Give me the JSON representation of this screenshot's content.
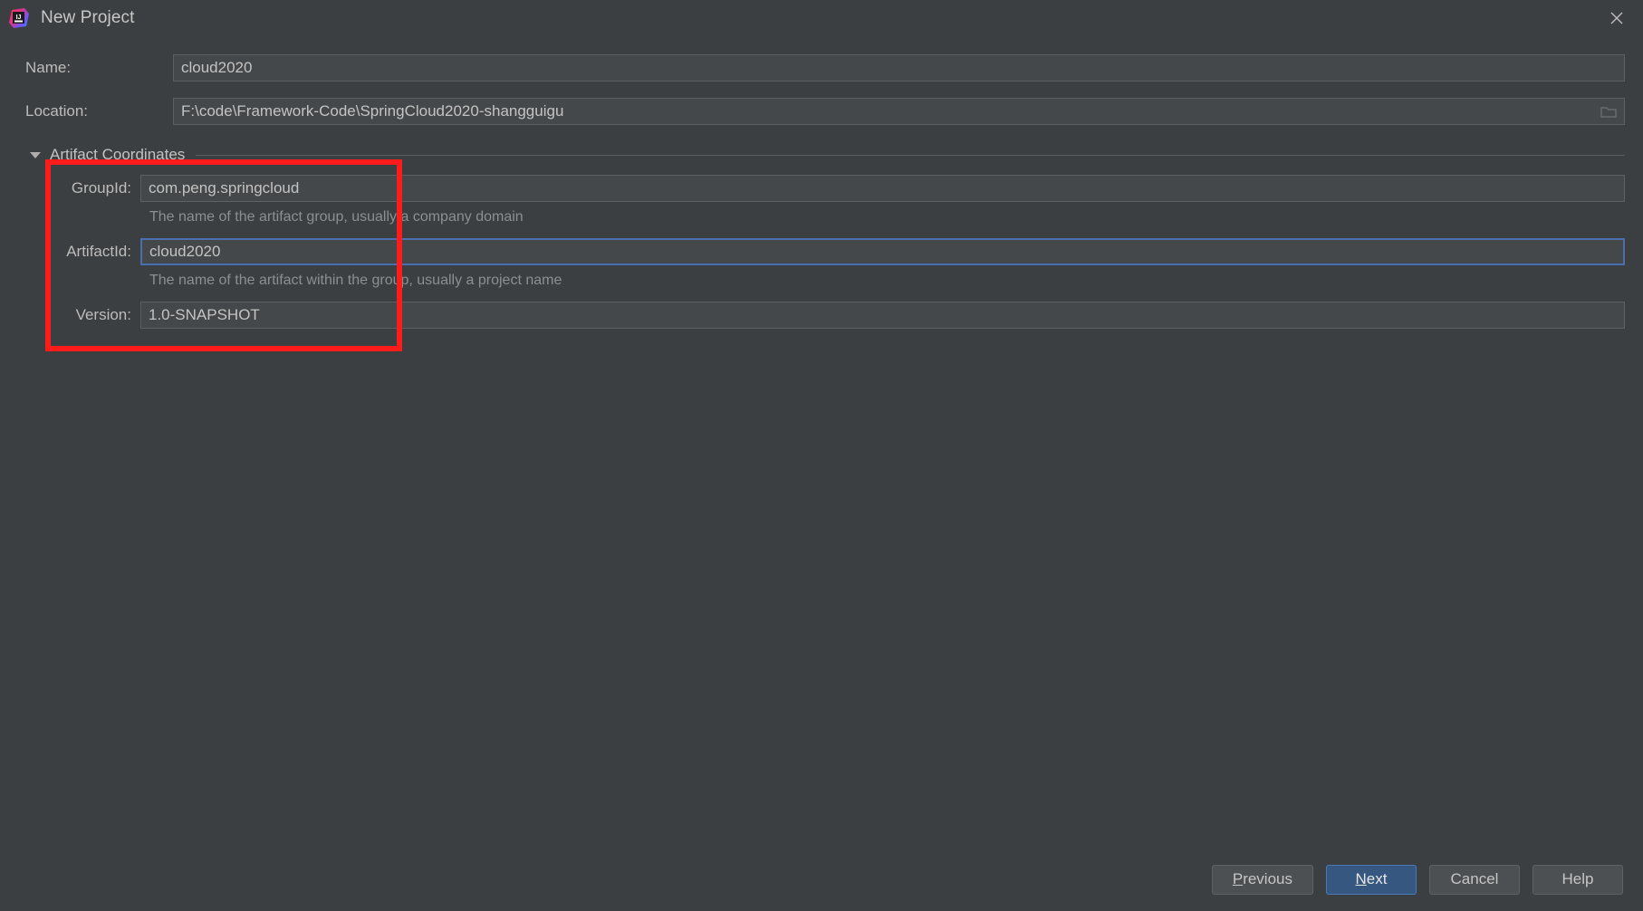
{
  "window": {
    "title": "New Project",
    "app_icon": "intellij-idea-logo",
    "close_icon": "close-icon"
  },
  "form": {
    "name_label": "Name:",
    "name_value": "cloud2020",
    "location_label": "Location:",
    "location_value": "F:\\code\\Framework-Code\\SpringCloud2020-shangguigu",
    "browse_icon": "folder-browse-icon"
  },
  "artifact_coordinates": {
    "section_title": "Artifact Coordinates",
    "expanded": true,
    "collapse_icon": "triangle-down-icon",
    "fields": [
      {
        "label": "GroupId:",
        "value": "com.peng.springcloud",
        "hint": "The name of the artifact group, usually a company domain",
        "focused": false
      },
      {
        "label": "ArtifactId:",
        "value": "cloud2020",
        "hint": "The name of the artifact within the group, usually a project name",
        "focused": true
      },
      {
        "label": "Version:",
        "value": "1.0-SNAPSHOT",
        "hint": "",
        "focused": false
      }
    ]
  },
  "annotation": {
    "highlight_color": "#fc1c1c"
  },
  "buttons": {
    "previous": {
      "label": "Previous",
      "mnemonic": "P",
      "primary": false
    },
    "next": {
      "label": "Next",
      "mnemonic": "N",
      "primary": true
    },
    "cancel": {
      "label": "Cancel",
      "mnemonic": "",
      "primary": false
    },
    "help": {
      "label": "Help",
      "mnemonic": "",
      "primary": false
    }
  },
  "colors": {
    "dialog_bg": "#3c3f41",
    "field_bg": "#45484a",
    "field_border": "#5e6060",
    "focus_border": "#4b6eaf",
    "primary_button": "#365880",
    "text": "#bbbbbb",
    "hint_text": "#8c8f91"
  }
}
